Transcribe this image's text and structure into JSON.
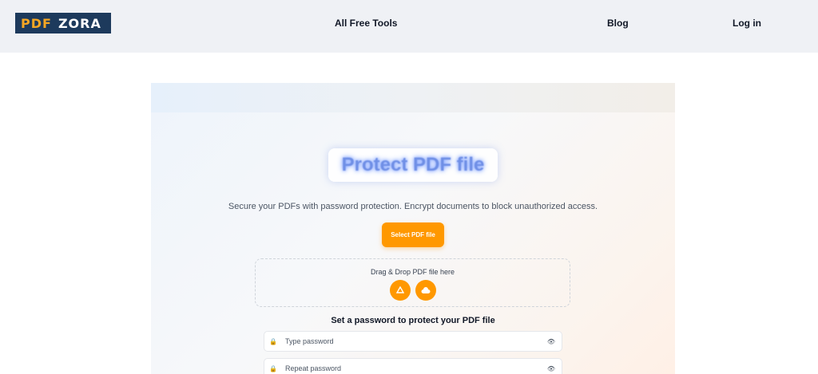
{
  "header": {
    "logo": {
      "part1": "PDF",
      "part2": "ZORA"
    },
    "nav": {
      "tools": "All Free Tools",
      "blog": "Blog",
      "login": "Log in"
    }
  },
  "main": {
    "title": "Protect PDF file",
    "subtitle": "Secure your PDFs with password protection. Encrypt documents to block unauthorized access.",
    "select_button": "Select PDF file",
    "dropzone_text": "Drag & Drop PDF file here",
    "password_heading": "Set a password to protect your PDF file",
    "password_field": {
      "placeholder": "Type password",
      "icon": "lock-icon",
      "toggle_icon": "eye-icon"
    },
    "repeat_field": {
      "placeholder": "Repeat password",
      "icon": "lock-icon",
      "toggle_icon": "eye-icon"
    }
  },
  "colors": {
    "accent": "#ff9800",
    "logo_bg": "#1d3a5c",
    "logo_orange": "#f5a623",
    "title": "#6f8fe6"
  }
}
